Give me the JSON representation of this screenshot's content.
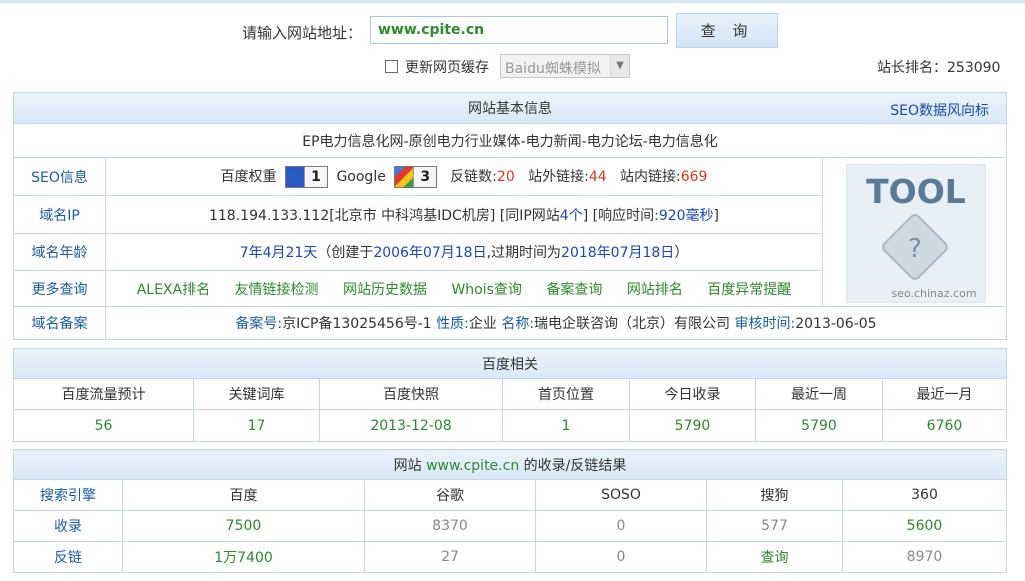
{
  "search": {
    "label": "请输入网站地址：",
    "value": "www.cpite.cn",
    "button": "查 询",
    "refresh_label": "更新网页缓存",
    "refresh_checked": false,
    "ua_select": "Baidu蜘蛛模拟",
    "rank_label": "站长排名：",
    "rank_value": "253090"
  },
  "basic": {
    "title": "网站基本信息",
    "seo_link": "SEO数据风向标",
    "site_title": "EP电力信息化网-原创电力行业媒体-电力新闻-电力论坛-电力信息化",
    "seo": {
      "label": "SEO信息",
      "bd_weight": "百度权重",
      "bd_value": "1",
      "google": "Google",
      "google_value": "3",
      "backlinks_label": "反链数:",
      "backlinks": "20",
      "outlinks_label": "站外链接:",
      "outlinks": "44",
      "inlinks_label": "站内链接:",
      "inlinks": "669"
    },
    "ip": {
      "label": "域名IP",
      "value": "118.194.133.112[北京市 中科鸿基IDC机房]",
      "same_ip_pre": "[同IP网站",
      "same_ip": "4个",
      "same_ip_post": "]",
      "resp_pre": "[响应时间:",
      "resp": "920毫秒",
      "resp_post": "]"
    },
    "age": {
      "label": "域名年龄",
      "age": "7年4月21天",
      "created_pre": "（创建于",
      "created": "2006年07月18日",
      "expire_pre": ",过期时间为",
      "expire": "2018年07月18日",
      "post": "）"
    },
    "more": {
      "label": "更多查询",
      "links": [
        "ALEXA排名",
        "友情链接检测",
        "网站历史数据",
        "Whois查询",
        "备案查询",
        "网站排名",
        "百度异常提醒"
      ]
    },
    "icp": {
      "label": "域名备案",
      "no_label": "备案号:",
      "no": "京ICP备13025456号-1",
      "type_label": "性质:",
      "type": "企业",
      "name_label": "名称:",
      "name": "瑞电企联咨询（北京）有限公司",
      "time_label": "审核时间:",
      "time": "2013-06-05"
    },
    "thumb": {
      "big": "TOOL",
      "small": "seo.chinaz.com"
    }
  },
  "baidu": {
    "title": "百度相关",
    "headers": [
      "百度流量预计",
      "关键词库",
      "百度快照",
      "首页位置",
      "今日收录",
      "最近一周",
      "最近一月"
    ],
    "values": [
      "56",
      "17",
      "2013-12-08",
      "1",
      "5790",
      "5790",
      "6760"
    ]
  },
  "engines": {
    "title_pre": "网站",
    "title_site": "www.cpite.cn",
    "title_post": "的收录/反链结果",
    "headers": [
      "搜索引擎",
      "百度",
      "谷歌",
      "SOSO",
      "搜狗",
      "360"
    ],
    "rows": [
      {
        "label": "收录",
        "values": [
          "7500",
          "8370",
          "0",
          "577",
          "5600"
        ]
      },
      {
        "label": "反链",
        "values": [
          "1万7400",
          "27",
          "0",
          "查询",
          "8970"
        ]
      }
    ]
  },
  "colors": {
    "link": "#1b5ea3",
    "green": "#2c8a2c",
    "red": "#d83a1a",
    "header_bg": "#dbe9f7"
  }
}
